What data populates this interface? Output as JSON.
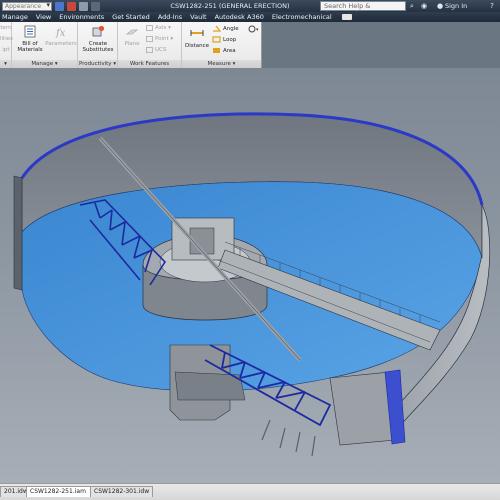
{
  "titlebar": {
    "appearance_value": "Appearance",
    "document_title": "CSW1282-251 (GENERAL ERECTION)",
    "search_placeholder": "Search Help & Commands...",
    "signin_label": "Sign In"
  },
  "menu": {
    "items": [
      "Manage",
      "View",
      "Environments",
      "Get Started",
      "Add-Ins",
      "Vault",
      "Autodesk A360",
      "Electromechanical"
    ]
  },
  "ribbon": {
    "left_clip_labels": [
      "tern",
      "lities",
      "ipt"
    ],
    "manage_buttons": [
      "Bill of",
      "Materials",
      "Parameters"
    ],
    "productivity_button": [
      "Create",
      "Substitutes"
    ],
    "work_features": [
      "Plane",
      "Axis",
      "Point",
      "UCS"
    ],
    "measure_buttons": [
      "Distance",
      "Angle",
      "Loop",
      "Area"
    ],
    "panel_labels": {
      "manage": "Manage",
      "productivity": "Productivity",
      "work_features": "Work Features",
      "measure": "Measure"
    }
  },
  "tabs": {
    "items": [
      {
        "label": "201.idw",
        "active": false
      },
      {
        "label": "CSW1282-251.iam",
        "active": true
      },
      {
        "label": "CSW1282-301.idw",
        "active": false
      }
    ]
  },
  "colors": {
    "water": "#3f8fd8",
    "truss": "#1c2aa0",
    "concrete": "#8f959b",
    "titlebar": "#2b394a"
  }
}
